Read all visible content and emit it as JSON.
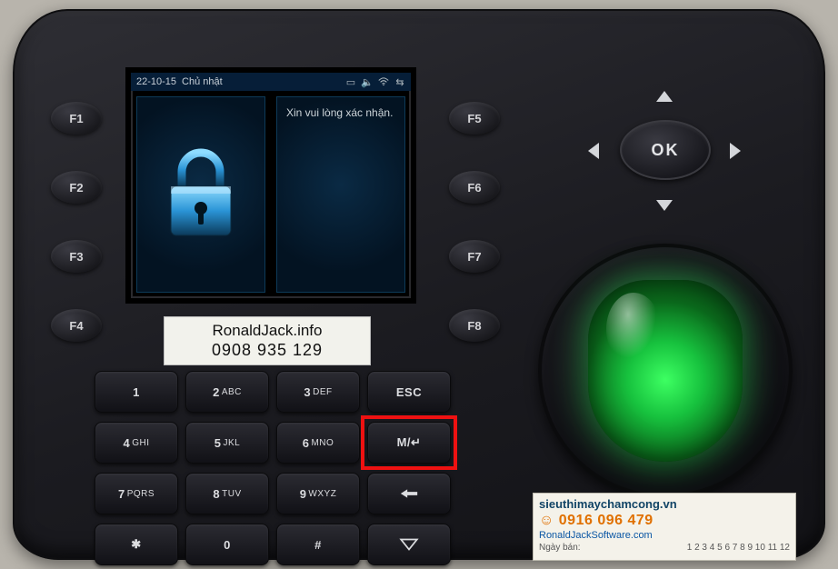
{
  "statusbar": {
    "date": "22-10-15",
    "day": "Chủ nhật"
  },
  "screen": {
    "message": "Xin vui lòng xác nhận."
  },
  "f_left": [
    "F1",
    "F2",
    "F3",
    "F4"
  ],
  "f_right": [
    "F5",
    "F6",
    "F7",
    "F8"
  ],
  "keypad": {
    "k1": "1",
    "k2": "2",
    "k2s": "ABC",
    "k3": "3",
    "k3s": "DEF",
    "esc": "ESC",
    "k4": "4",
    "k4s": "GHI",
    "k5": "5",
    "k5s": "JKL",
    "k6": "6",
    "k6s": "MNO",
    "menu": "M/↵",
    "k7": "7",
    "k7s": "PQRS",
    "k8": "8",
    "k8s": "TUV",
    "k9": "9",
    "k9s": "WXYZ",
    "star": "✱",
    "k0": "0",
    "hash": "#"
  },
  "nav": {
    "ok": "OK"
  },
  "label1": {
    "line1": "RonaldJack.info",
    "line2": "0908 935  129"
  },
  "label2": {
    "site": "sieuthimaychamcong.vn",
    "phone": "0916 096 479",
    "soft": "RonaldJackSoftware.com",
    "sold": "Ngày bán:",
    "months": "1 2 3 4 5 6 7 8 9 10 11 12"
  }
}
